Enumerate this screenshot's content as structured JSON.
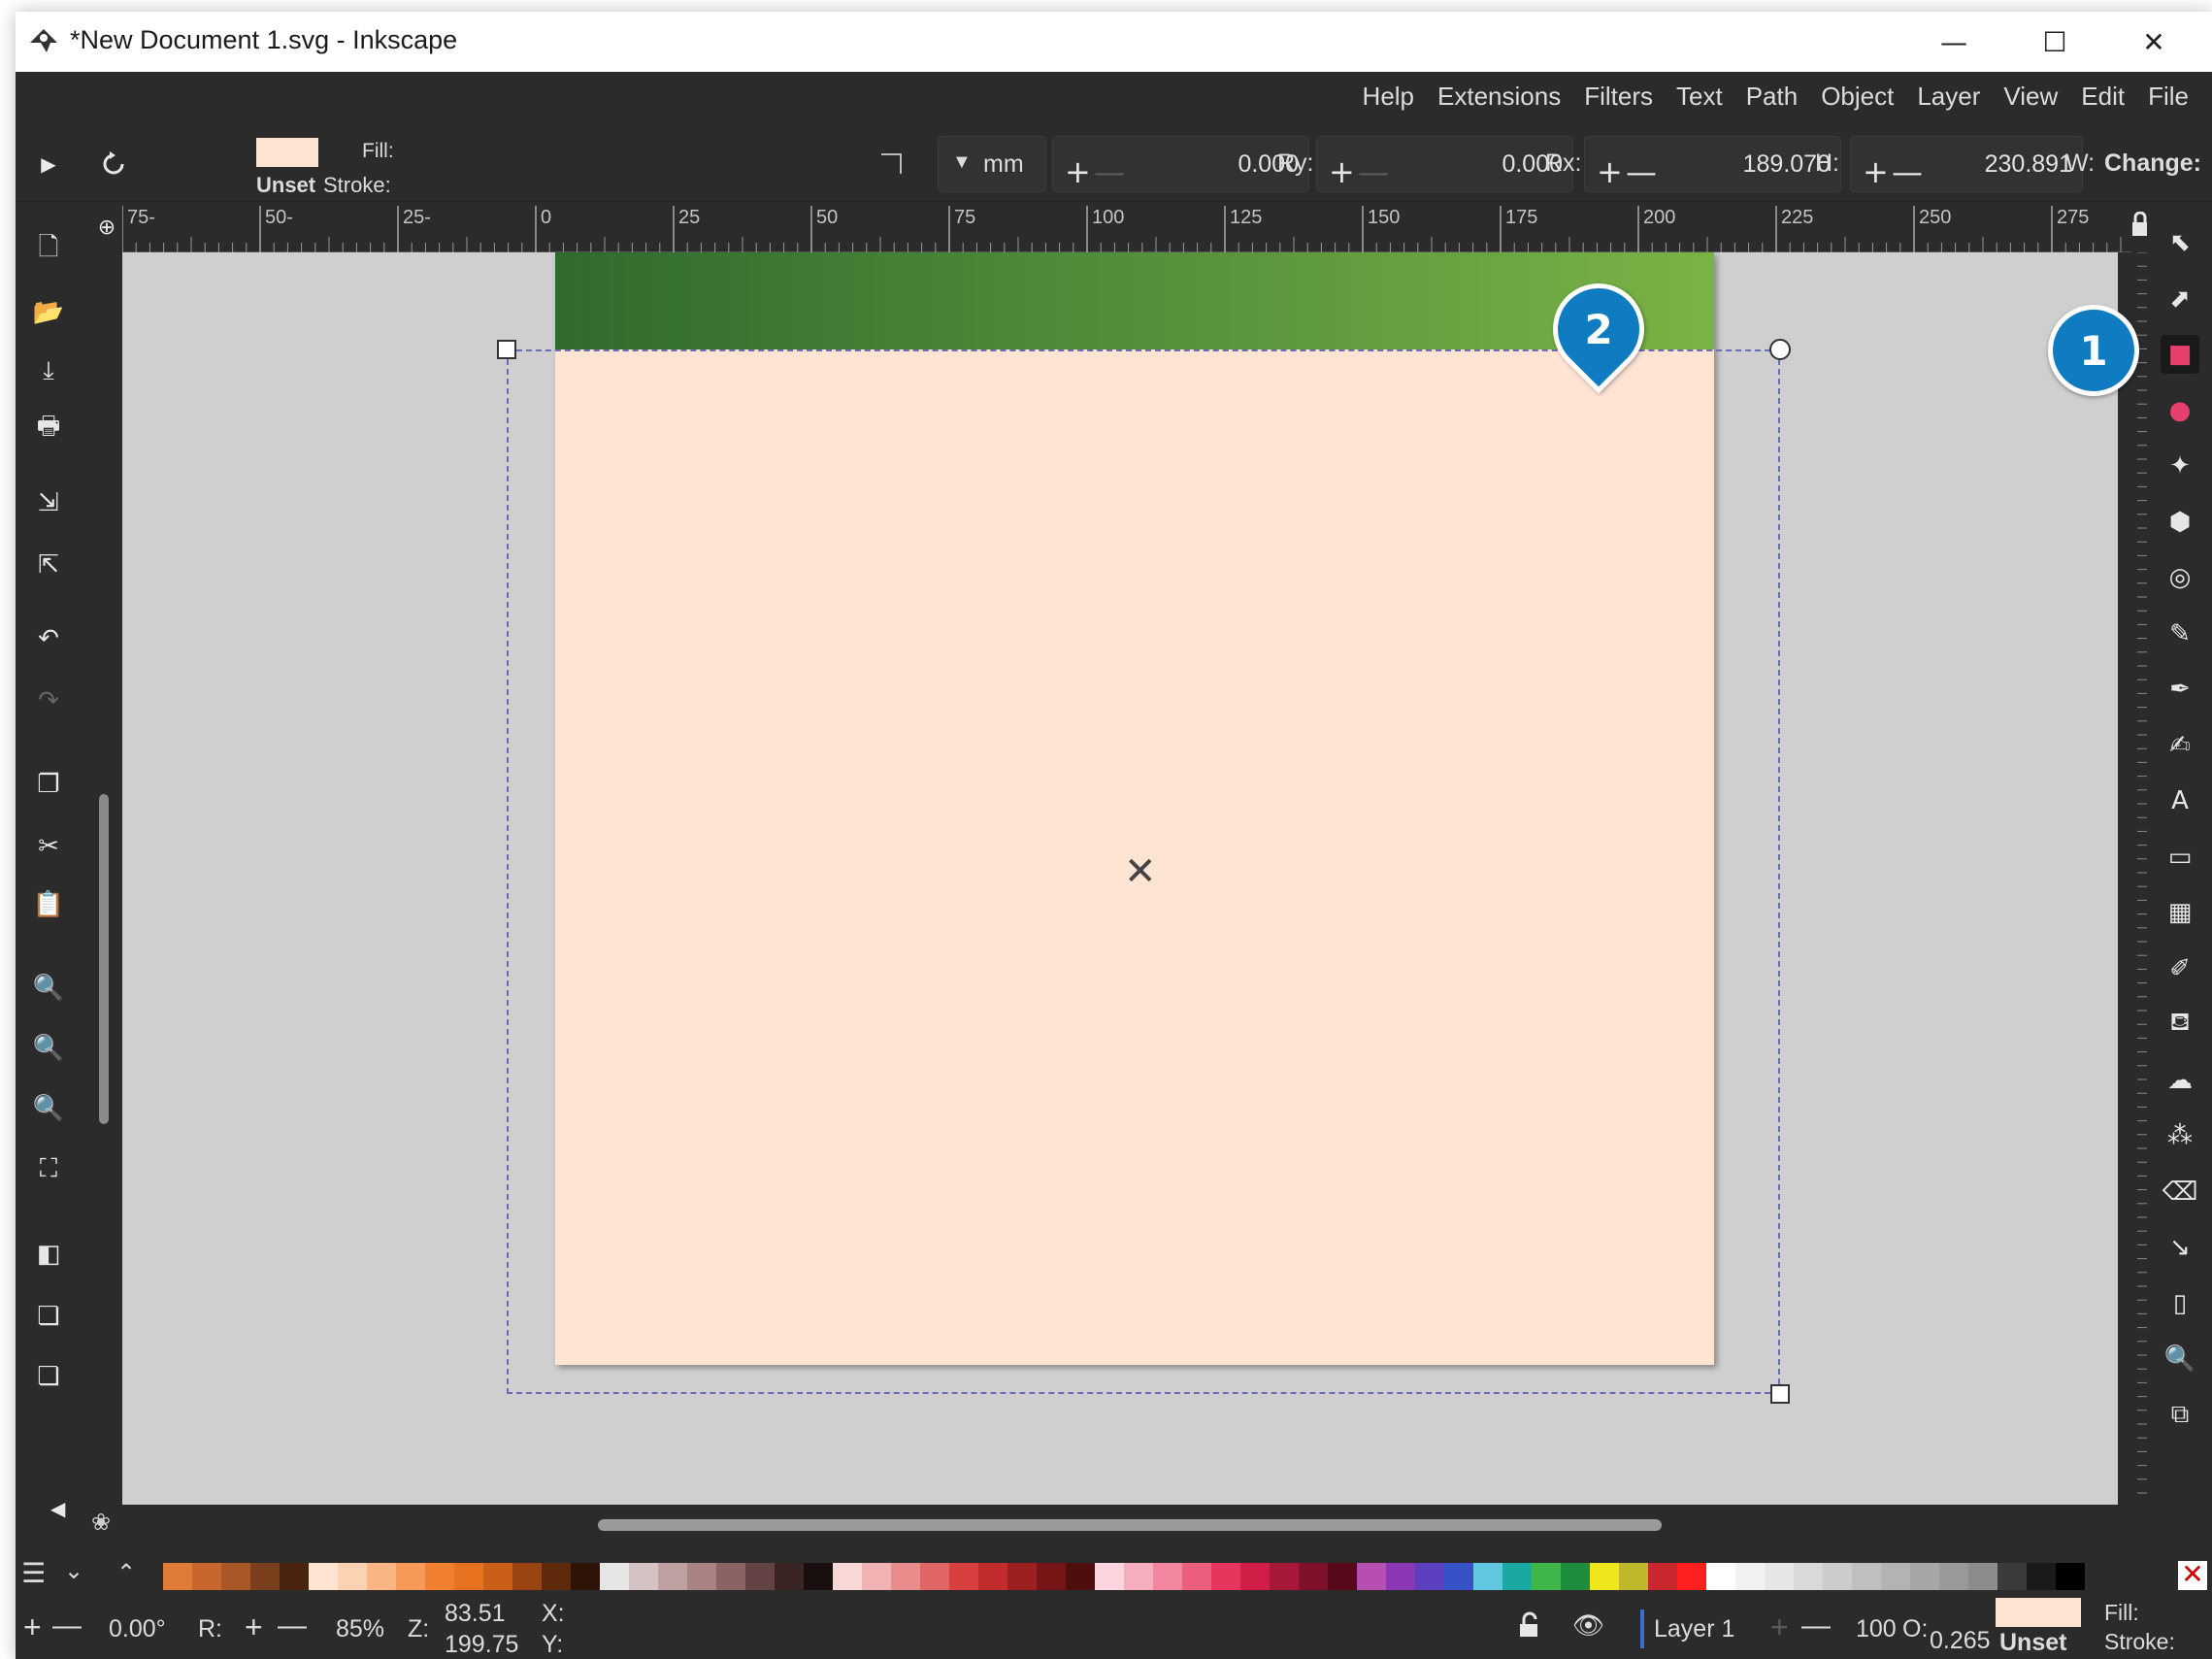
{
  "window": {
    "title": "*New Document 1.svg - Inkscape",
    "minimize_glyph": "—",
    "maximize_glyph": "☐",
    "close_glyph": "✕"
  },
  "menu": [
    "File",
    "Edit",
    "View",
    "Layer",
    "Object",
    "Path",
    "Text",
    "Filters",
    "Extensions",
    "Help"
  ],
  "tool_controls": {
    "fill_label": "Fill:",
    "fill_value": "Unset",
    "stroke_label": "Stroke:",
    "units": "mm",
    "change_label": "Change:",
    "w_label": "W:",
    "w_value": "230.891",
    "h_label": "H:",
    "h_value": "189.070",
    "rx_label": "Rx:",
    "rx_value": "0.000",
    "ry_label": "Ry:",
    "ry_value": "0.000",
    "plus": "+",
    "minus": "—",
    "colors": {
      "fill_swatch": "#fee4d3"
    }
  },
  "ruler": {
    "labels": [
      "75-",
      "50-",
      "25-",
      "0",
      "25",
      "50",
      "75",
      "100",
      "125",
      "150",
      "175",
      "200",
      "225",
      "250",
      "275"
    ]
  },
  "canvas": {
    "colors": {
      "page": "#fee4d3",
      "header_start": "#2f6a2c",
      "header_end": "#7ab345",
      "canvas_bg": "#cfcfcf"
    }
  },
  "left_toolbar": [
    "new-document-icon",
    "open-icon",
    "save-icon",
    "print-icon",
    "import-icon",
    "export-icon",
    "undo-icon",
    "redo-icon",
    "copy-icon",
    "cut-icon",
    "paste-icon",
    "zoom-selection-icon",
    "zoom-drawing-icon",
    "zoom-page-icon",
    "zoom-center-icon",
    "duplicate-icon",
    "clone-icon",
    "unlink-clone-icon"
  ],
  "right_toolbox": [
    "selector-icon",
    "node-icon",
    "rectangle-icon",
    "ellipse-icon",
    "star-icon",
    "3d-box-icon",
    "spiral-icon",
    "pencil-icon",
    "pen-icon",
    "calligraphy-icon",
    "text-icon",
    "gradient-icon",
    "mesh-icon",
    "dropper-icon",
    "paint-bucket-icon",
    "tweak-icon",
    "spray-icon",
    "eraser-icon",
    "connector-icon",
    "pages-icon",
    "zoom-icon",
    "measure-icon"
  ],
  "palette": {
    "colors": [
      "#e07b39",
      "#c7672e",
      "#a85727",
      "#7a3e1c",
      "#4a240f",
      "#fde3d1",
      "#fcd2b3",
      "#f9b583",
      "#f59a59",
      "#f08030",
      "#e6711f",
      "#c95f19",
      "#9a4511",
      "#5e2a0b",
      "#2e1406",
      "#e6e6e6",
      "#d4c3c3",
      "#bfa0a0",
      "#a98282",
      "#8a6363",
      "#634343",
      "#3b2424",
      "#1a0f0f",
      "#f8d7d7",
      "#f0b2b2",
      "#e88c8c",
      "#e06666",
      "#d84040",
      "#c22c2c",
      "#9c2020",
      "#751515",
      "#4e0d0d",
      "#fbd6df",
      "#f6aebe",
      "#f1869e",
      "#ec5e7e",
      "#e7365e",
      "#d01e47",
      "#a81838",
      "#80112a",
      "#58091c",
      "#b64fb1",
      "#8c37b4",
      "#5c3fbf",
      "#3651c6",
      "#5fc8e0",
      "#1aa8a3",
      "#3fb54a",
      "#1f8e3c",
      "#f0e61e",
      "#bfb82b",
      "#c8282e",
      "#ff1f1f",
      "#ffffff",
      "#f2f2f2",
      "#e6e6e6",
      "#d9d9d9",
      "#cccccc",
      "#bfbfbf",
      "#b3b3b3",
      "#a6a6a6",
      "#999999",
      "#8c8c8c",
      "#3a3a3a",
      "#1a1a1a",
      "#000000"
    ]
  },
  "status": {
    "rotation_value": "0.00°",
    "rotation_label": "R:",
    "zoom_value": "85%",
    "zoom_label": "Z:",
    "x_value": "83.51",
    "x_label": "X:",
    "y_value": "199.75",
    "y_label": "Y:",
    "layer_name": "Layer 1",
    "opacity_value": "100",
    "opacity_label": "O:",
    "stroke_width": "0.265",
    "fill_value": "Unset",
    "fill_label": "Fill:",
    "stroke_label": "Stroke:"
  },
  "callouts": [
    "1",
    "2"
  ]
}
